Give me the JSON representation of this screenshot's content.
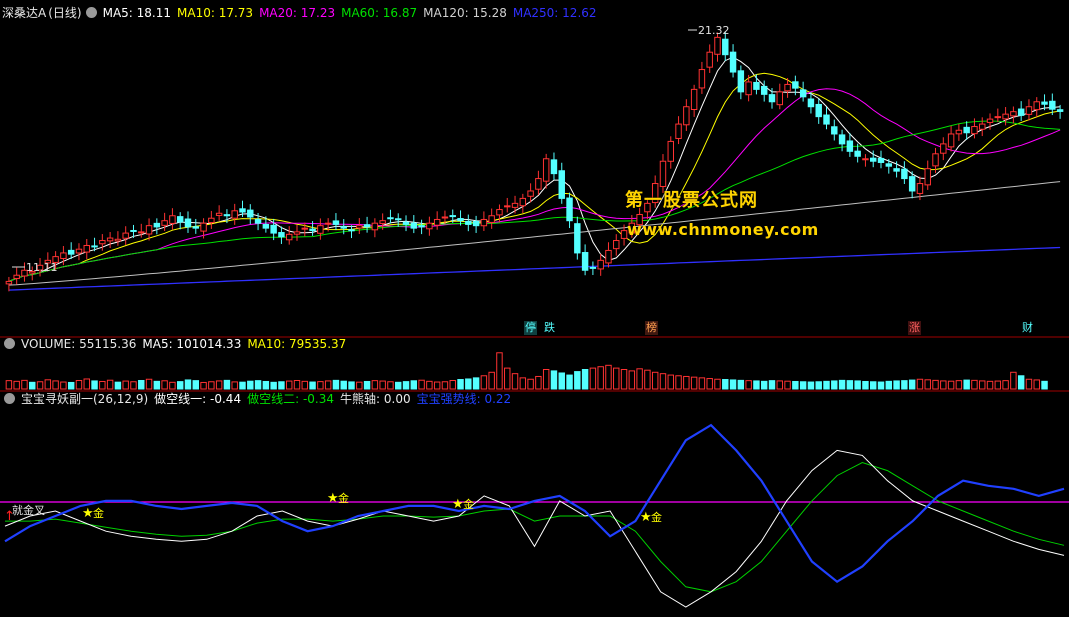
{
  "header_main": {
    "stock": "深桑达A",
    "period": "(日线)",
    "ma5": "MA5: 18.11",
    "ma10": "MA10: 17.73",
    "ma20": "MA20: 17.23",
    "ma60": "MA60: 16.87",
    "ma120": "MA120: 15.28",
    "ma250": "MA250: 12.62"
  },
  "header_volume": {
    "volume": "VOLUME: 55115.36",
    "ma5": "MA5: 101014.33",
    "ma10": "MA10: 79535.37"
  },
  "header_indicator": {
    "name": "宝宝寻妖副一(26,12,9)",
    "line1": "做空线一: -0.44",
    "line2": "做空线二: -0.34",
    "bull_axis": "牛熊轴: 0.00",
    "strong_line": "宝宝强势线: 0.22"
  },
  "annotations": {
    "high_price": "21.32",
    "low_price": "11.11",
    "gold": "金",
    "start_label": "就金叉"
  },
  "events": [
    "停",
    "跌",
    "榜",
    "涨",
    "财"
  ],
  "watermark": {
    "cn": "第一股票公式网",
    "url": "www.chnmoney.com"
  },
  "colors": {
    "up": "#ff3232",
    "down": "#54ffff",
    "ma5": "#ffffff",
    "ma10": "#ffff00",
    "ma20": "#ff00ff",
    "ma60": "#00e000",
    "ma120": "#c0c0c0",
    "ma250": "#3030ff",
    "bull_axis": "#ff00ff",
    "strong_line": "#2040ff"
  },
  "chart_data": [
    {
      "type": "candlestick",
      "title": "深桑达A (日线)",
      "price_range": [
        10.5,
        21.8
      ],
      "annotated_high": 21.32,
      "annotated_low": 11.11,
      "moving_averages": [
        {
          "name": "MA5",
          "last": 18.11
        },
        {
          "name": "MA10",
          "last": 17.73
        },
        {
          "name": "MA20",
          "last": 17.23
        },
        {
          "name": "MA60",
          "last": 16.87
        },
        {
          "name": "MA120",
          "last": 15.28
        },
        {
          "name": "MA250",
          "last": 12.62
        }
      ],
      "close": [
        11.25,
        11.5,
        11.7,
        11.65,
        11.9,
        12.1,
        12.25,
        12.4,
        12.35,
        12.55,
        12.7,
        12.65,
        12.9,
        13.0,
        12.95,
        13.2,
        13.3,
        13.25,
        13.5,
        13.45,
        13.7,
        13.9,
        13.65,
        13.45,
        13.4,
        13.6,
        13.8,
        14.0,
        13.9,
        14.1,
        14.05,
        13.85,
        13.6,
        13.4,
        13.2,
        13.05,
        13.15,
        13.25,
        13.4,
        13.3,
        13.5,
        13.6,
        13.55,
        13.4,
        13.3,
        13.5,
        13.45,
        13.6,
        13.7,
        13.8,
        13.75,
        13.55,
        13.4,
        13.45,
        13.6,
        13.75,
        13.85,
        13.9,
        13.7,
        13.55,
        13.5,
        13.75,
        13.9,
        14.15,
        14.3,
        14.4,
        14.6,
        14.9,
        15.4,
        16.2,
        15.6,
        14.6,
        13.7,
        12.4,
        11.7,
        11.8,
        12.1,
        12.5,
        12.9,
        13.3,
        13.6,
        13.95,
        14.4,
        15.2,
        16.1,
        16.9,
        17.6,
        18.3,
        19.0,
        19.8,
        20.5,
        21.1,
        20.4,
        19.7,
        18.9,
        19.3,
        19.0,
        18.8,
        18.5,
        18.9,
        19.2,
        19.05,
        18.7,
        18.3,
        17.9,
        17.6,
        17.2,
        16.8,
        16.5,
        16.3,
        16.2,
        16.1,
        16.05,
        15.9,
        15.7,
        15.4,
        14.9,
        15.2,
        15.8,
        16.4,
        16.8,
        17.2,
        17.35,
        17.25,
        17.5,
        17.6,
        17.8,
        17.9,
        18.0,
        18.1,
        17.95,
        18.3,
        18.5,
        18.4,
        18.2,
        18.11
      ]
    },
    {
      "type": "bar",
      "title": "VOLUME",
      "volume_last": 55115.36,
      "ma5_last": 101014.33,
      "ma10_last": 79535.37,
      "ylim": [
        0,
        280000
      ],
      "values": [
        60000,
        55000,
        62000,
        48000,
        52000,
        66000,
        58000,
        50000,
        47000,
        61000,
        72000,
        58000,
        54000,
        63000,
        49000,
        57000,
        52000,
        61000,
        70000,
        55000,
        59000,
        48000,
        53000,
        65000,
        60000,
        47000,
        52000,
        58000,
        62000,
        51000,
        49000,
        56000,
        60000,
        54000,
        48000,
        52000,
        57000,
        61000,
        55000,
        50000,
        53000,
        58000,
        62000,
        56000,
        51000,
        49000,
        54000,
        60000,
        57000,
        52000,
        48000,
        53000,
        59000,
        63000,
        55000,
        50000,
        52000,
        61000,
        68000,
        72000,
        80000,
        95000,
        120000,
        260000,
        150000,
        110000,
        80000,
        70000,
        90000,
        140000,
        130000,
        115000,
        100000,
        125000,
        140000,
        150000,
        160000,
        170000,
        150000,
        140000,
        130000,
        145000,
        135000,
        120000,
        110000,
        100000,
        95000,
        90000,
        85000,
        80000,
        75000,
        70000,
        68000,
        65000,
        62000,
        60000,
        58000,
        55000,
        60000,
        58000,
        56000,
        54000,
        52000,
        50000,
        52000,
        55000,
        58000,
        62000,
        60000,
        58000,
        54000,
        52000,
        50000,
        55000,
        58000,
        60000,
        64000,
        70000,
        66000,
        62000,
        58000,
        56000,
        60000,
        64000,
        62000,
        58000,
        55000,
        57000,
        60000,
        120000,
        95000,
        70000,
        65000,
        55115
      ]
    },
    {
      "type": "line",
      "title": "宝宝寻妖副一(26,12,9)",
      "ylim": [
        -1.0,
        1.0
      ],
      "series": [
        {
          "name": "做空线一",
          "last": -0.44,
          "values": [
            -0.15,
            -0.05,
            0.0,
            -0.1,
            -0.2,
            -0.25,
            -0.28,
            -0.3,
            -0.28,
            -0.2,
            -0.05,
            0.0,
            -0.1,
            -0.15,
            -0.08,
            0.0,
            -0.05,
            -0.1,
            -0.05,
            0.15,
            0.05,
            -0.35,
            0.1,
            -0.05,
            0.0,
            -0.4,
            -0.8,
            -0.95,
            -0.8,
            -0.6,
            -0.3,
            0.1,
            0.4,
            0.6,
            0.55,
            0.3,
            0.1,
            0.0,
            -0.1,
            -0.2,
            -0.3,
            -0.38,
            -0.44
          ]
        },
        {
          "name": "做空线二",
          "last": -0.34,
          "values": [
            -0.1,
            -0.1,
            -0.08,
            -0.12,
            -0.16,
            -0.2,
            -0.23,
            -0.25,
            -0.24,
            -0.2,
            -0.12,
            -0.08,
            -0.08,
            -0.1,
            -0.08,
            -0.05,
            -0.05,
            -0.06,
            -0.05,
            0.0,
            0.02,
            -0.1,
            -0.05,
            -0.05,
            -0.05,
            -0.2,
            -0.5,
            -0.75,
            -0.8,
            -0.7,
            -0.5,
            -0.2,
            0.1,
            0.35,
            0.48,
            0.4,
            0.25,
            0.1,
            0.0,
            -0.1,
            -0.2,
            -0.28,
            -0.34
          ]
        },
        {
          "name": "牛熊轴",
          "last": 0.0
        },
        {
          "name": "宝宝强势线",
          "last": 0.22,
          "values": [
            -0.3,
            -0.15,
            -0.05,
            0.05,
            0.1,
            0.1,
            0.05,
            0.02,
            0.05,
            0.08,
            0.05,
            -0.1,
            -0.2,
            -0.15,
            -0.05,
            0.0,
            0.05,
            0.05,
            0.0,
            0.05,
            0.02,
            0.1,
            0.15,
            0.0,
            -0.25,
            -0.1,
            0.3,
            0.7,
            0.85,
            0.6,
            0.3,
            -0.1,
            -0.5,
            -0.7,
            -0.55,
            -0.3,
            -0.1,
            0.15,
            0.3,
            0.25,
            0.22,
            0.15,
            0.22
          ]
        }
      ]
    }
  ]
}
